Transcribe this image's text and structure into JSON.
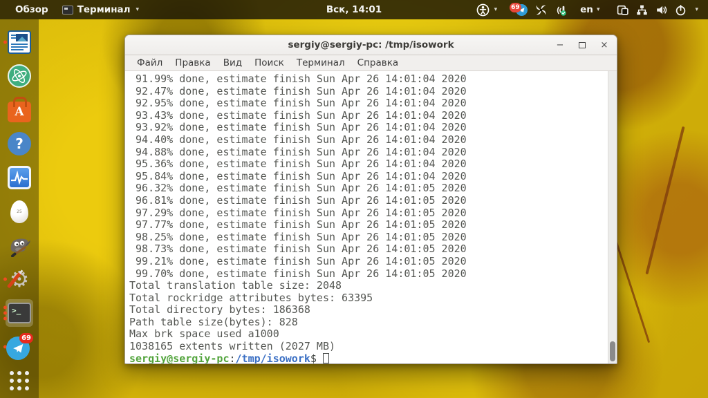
{
  "topbar": {
    "activities_label": "Обзор",
    "app_menu_label": "Терминал",
    "clock": "Вск, 14:01",
    "tray": {
      "telegram_badge": "69",
      "keyboard_layout": "en"
    }
  },
  "dock": {
    "telegram_badge": "69",
    "egg_text": "25"
  },
  "window": {
    "title": "sergiy@sergiy-pc: /tmp/isowork",
    "controls": {
      "minimize": "−",
      "close": "×"
    },
    "menu": [
      "Файл",
      "Правка",
      "Вид",
      "Поиск",
      "Терминал",
      "Справка"
    ],
    "terminal": {
      "output_lines": [
        "91.99% done, estimate finish Sun Apr 26 14:01:04 2020",
        "92.47% done, estimate finish Sun Apr 26 14:01:04 2020",
        "92.95% done, estimate finish Sun Apr 26 14:01:04 2020",
        "93.43% done, estimate finish Sun Apr 26 14:01:04 2020",
        "93.92% done, estimate finish Sun Apr 26 14:01:04 2020",
        "94.40% done, estimate finish Sun Apr 26 14:01:04 2020",
        "94.88% done, estimate finish Sun Apr 26 14:01:04 2020",
        "95.36% done, estimate finish Sun Apr 26 14:01:04 2020",
        "95.84% done, estimate finish Sun Apr 26 14:01:04 2020",
        "96.32% done, estimate finish Sun Apr 26 14:01:05 2020",
        "96.81% done, estimate finish Sun Apr 26 14:01:05 2020",
        "97.29% done, estimate finish Sun Apr 26 14:01:05 2020",
        "97.77% done, estimate finish Sun Apr 26 14:01:05 2020",
        "98.25% done, estimate finish Sun Apr 26 14:01:05 2020",
        "98.73% done, estimate finish Sun Apr 26 14:01:05 2020",
        "99.21% done, estimate finish Sun Apr 26 14:01:05 2020",
        "99.70% done, estimate finish Sun Apr 26 14:01:05 2020",
        "Total translation table size: 2048",
        "Total rockridge attributes bytes: 63395",
        "Total directory bytes: 186368",
        "Path table size(bytes): 828",
        "Max brk space used a1000",
        "1038165 extents written (2027 MB)"
      ],
      "prompt": {
        "user": "sergiy@sergiy-pc",
        "separator": ":",
        "path": "/tmp/isowork",
        "symbol": "$"
      }
    }
  },
  "colors": {
    "prompt_user_green": "#52a43c",
    "prompt_path_blue": "#3a6fc4",
    "terminal_foreground": "#555753",
    "badge_red": "#e8291d",
    "telegram_blue": "#37a8e0",
    "software_orange": "#e9641e",
    "wallpaper_yellow": "#dcbd0b"
  }
}
